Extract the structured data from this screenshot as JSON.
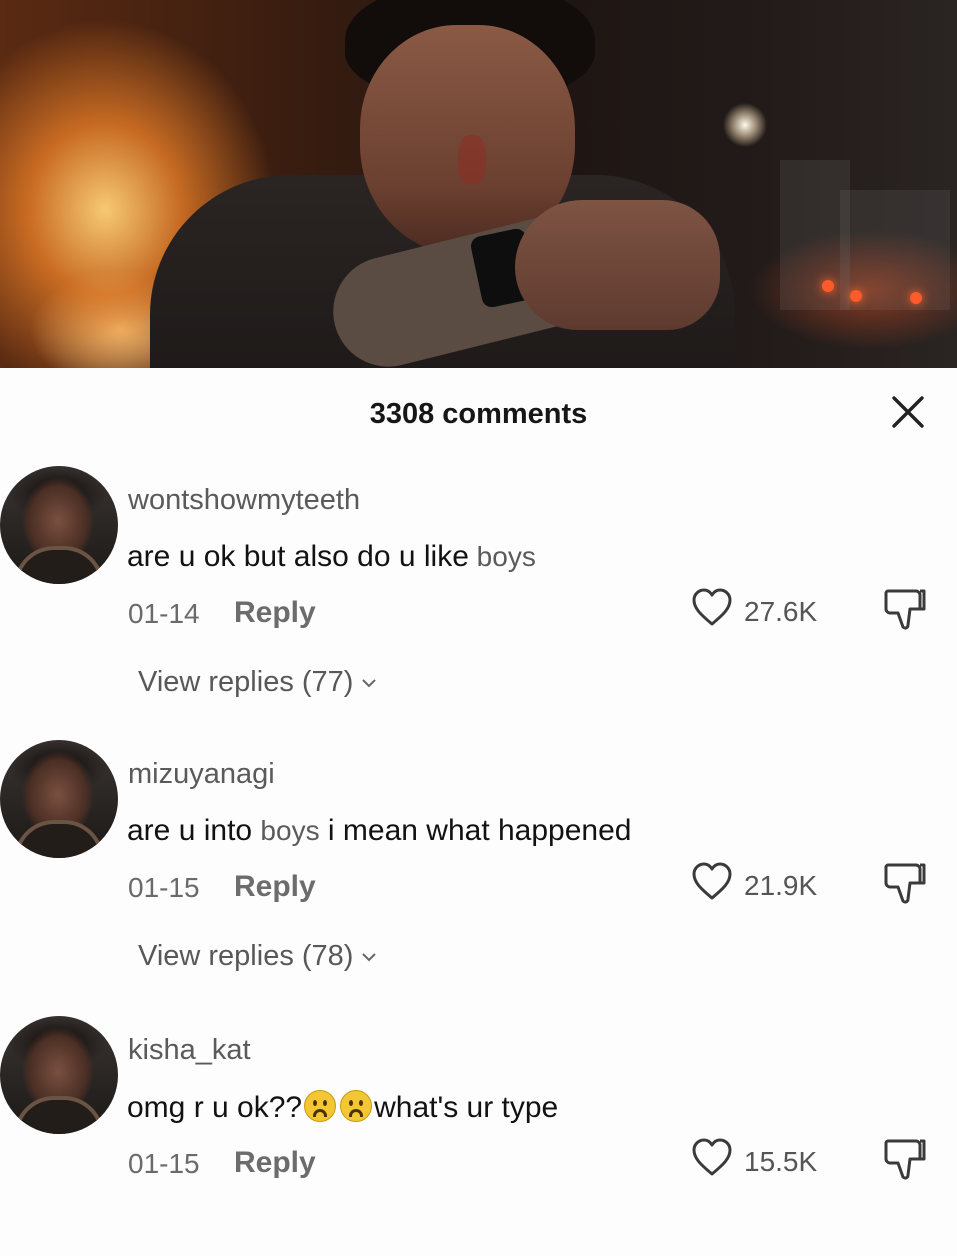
{
  "sheet": {
    "title": "3308 comments"
  },
  "comments": [
    {
      "username": "wontshowmyteeth",
      "text_main": "are u ok but also do u like",
      "text_tail": " boys",
      "date": "01-14",
      "reply_label": "Reply",
      "likes": "27.6K",
      "view_replies": "View replies (77)"
    },
    {
      "username": "mizuyanagi",
      "text_a": "are u into ",
      "text_b": "boys",
      "text_c": " i mean what happened",
      "date": "01-15",
      "reply_label": "Reply",
      "likes": "21.9K",
      "view_replies": "View replies (78)"
    },
    {
      "username": "kisha_kat",
      "text_a": "omg r u ok??",
      "text_b": "what's ur type",
      "date": "01-15",
      "reply_label": "Reply",
      "likes": "15.5K"
    }
  ],
  "icons": {
    "close": "close-icon",
    "like": "heart-outline-icon",
    "dislike": "thumbs-down-icon",
    "expand": "chevron-down-icon",
    "emoji": "frowning-face-emoji"
  }
}
